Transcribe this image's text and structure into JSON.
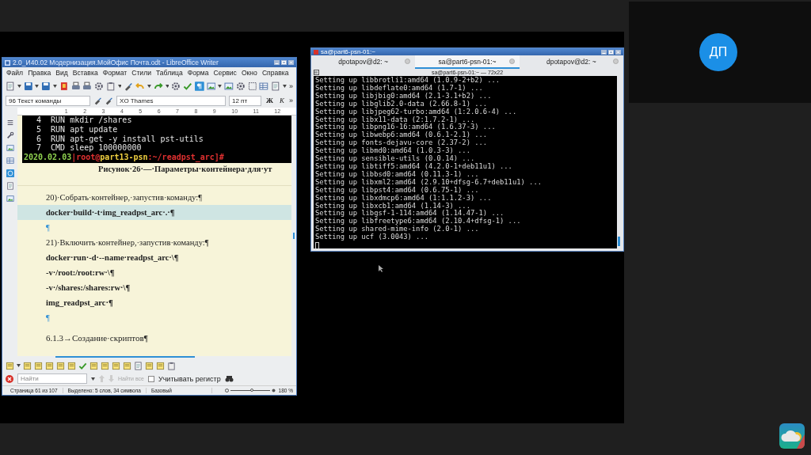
{
  "writer": {
    "title": "2.0_И40.02 Модернизация.МойОфис Почта.odt - LibreOffice Writer",
    "menu": [
      "Файл",
      "Правка",
      "Вид",
      "Вставка",
      "Формат",
      "Стили",
      "Таблица",
      "Форма",
      "Сервис",
      "Окно",
      "Справка"
    ],
    "toolbar_more": "»",
    "paragraph_style": "96 Текст команды",
    "font_name": "XO Thames",
    "font_size": "12 пт",
    "bold_button": "Ж",
    "italic_button": "К",
    "format_more": "»",
    "ruler": [
      "1",
      "2",
      "3",
      "4",
      "5",
      "6",
      "7",
      "8",
      "9",
      "10",
      "11",
      "12"
    ],
    "screenshot": {
      "lines": [
        "4  RUN mkdir /shares",
        "5  RUN apt update",
        "6  RUN apt-get -y install pst-utils",
        "7  CMD sleep 100000000"
      ],
      "prompt": [
        {
          "text": "2020.02.03",
          "color": "#8fd14f"
        },
        {
          "text": "|root@",
          "color": "#e03030"
        },
        {
          "text": "part13-psn",
          "color": "#f0d040"
        },
        {
          "text": ":~/readpst_arc]#",
          "color": "#e03030"
        }
      ]
    },
    "caption": "Рисунок·26·—·Параметры·контейнера·для·ут",
    "paragraphs": [
      {
        "kind": "text",
        "text": "20)·Собрать·контейнер,·запустив·команду:¶",
        "selected": false
      },
      {
        "kind": "code",
        "text": "docker·build·-t·img_readpst_arc·.·¶",
        "selected": true
      },
      {
        "kind": "empty",
        "text": "¶",
        "selected": false
      },
      {
        "kind": "text",
        "text": "21)·Включить·контейнер,·запустив·команду:¶",
        "selected": false
      },
      {
        "kind": "code",
        "text": "docker·run·-d·--name·readpst_arc·\\¶",
        "selected": false
      },
      {
        "kind": "code",
        "text": "-v·/root:/root:rw·\\¶",
        "selected": false
      },
      {
        "kind": "code",
        "text": "-v·/shares:/shares:rw·\\¶",
        "selected": false
      },
      {
        "kind": "code",
        "text": "img_readpst_arc·¶",
        "selected": false
      },
      {
        "kind": "empty",
        "text": "¶",
        "selected": false
      },
      {
        "kind": "heading",
        "text": "6.1.3→Создание·скриптов¶",
        "selected": false
      }
    ],
    "find_bar": {
      "placeholder": "Найти",
      "find_all": "Найти все",
      "find_all_disabled": true,
      "match_case": {
        "label": "Учитывать регистр",
        "checked": false
      }
    },
    "status_bar": {
      "page": "Страница 61 из 107",
      "selection": "Выделено: 5 слов, 34 символа",
      "page_style": "Базовый",
      "zoom_slider": {
        "level": 0.55
      },
      "zoom": "180 %"
    }
  },
  "terminal": {
    "title": "sa@part6-psn-01:~",
    "tabs": [
      {
        "label": "dpotapov@d2: ~",
        "selected": false
      },
      {
        "label": "sa@part6-psn-01:~",
        "selected": true
      },
      {
        "label": "dpotapov@d2: ~",
        "selected": false
      }
    ],
    "header": "sa@part6-psn-01:~ — 72x22",
    "lines": [
      "Setting up libbrotli1:amd64 (1.0.9-2+b2) ...",
      "Setting up libdeflate0:amd64 (1.7-1) ...",
      "Setting up libjbig0:amd64 (2.1-3.1+b2) ...",
      "Setting up libglib2.0-data (2.66.8-1) ...",
      "Setting up libjpeg62-turbo:amd64 (1:2.0.6-4) ...",
      "Setting up libx11-data (2:1.7.2-1) ...",
      "Setting up libpng16-16:amd64 (1.6.37-3) ...",
      "Setting up libwebp6:amd64 (0.6.1-2.1) ...",
      "Setting up fonts-dejavu-core (2.37-2) ...",
      "Setting up libmd0:amd64 (1.0.3-3) ...",
      "Setting up sensible-utils (0.0.14) ...",
      "Setting up libtiff5:amd64 (4.2.0-1+deb11u1) ...",
      "Setting up libbsd0:amd64 (0.11.3-1) ...",
      "Setting up libxml2:amd64 (2.9.10+dfsg-6.7+deb11u1) ...",
      "Setting up libpst4:amd64 (0.6.75-1) ...",
      "Setting up libxdmcp6:amd64 (1:1.1.2-3) ...",
      "Setting up libxcb1:amd64 (1.14-3) ...",
      "Setting up libgsf-1-114:amd64 (1.14.47-1) ...",
      "Setting up libfreetype6:amd64 (2.10.4+dfsg-1) ...",
      "Setting up shared-mime-info (2.0-1) ...",
      "Setting up ucf (3.0043) ..."
    ]
  },
  "participant": {
    "initials": "ДП"
  }
}
